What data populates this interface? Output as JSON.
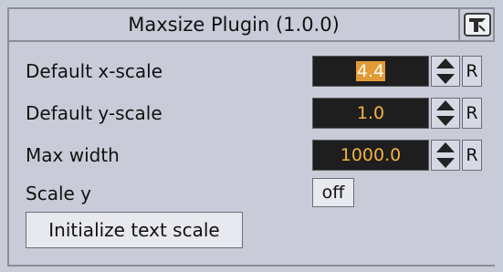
{
  "header": {
    "title": "Maxsize Plugin (1.0.0)",
    "icon": "plugin-info-icon"
  },
  "fields": [
    {
      "label": "Default x-scale",
      "value": "4.4",
      "selected": true,
      "reset_label": "R"
    },
    {
      "label": "Default y-scale",
      "value": "1.0",
      "selected": false,
      "reset_label": "R"
    },
    {
      "label": "Max width",
      "value": "1000.0",
      "selected": false,
      "reset_label": "R"
    }
  ],
  "scale_y": {
    "label": "Scale y",
    "value": "off"
  },
  "actions": {
    "initialize_label": "Initialize text scale"
  },
  "colors": {
    "panel_bg": "#c9ccd8",
    "field_bg": "#1e1e1e",
    "field_text": "#f3b23f",
    "selection": "#e29a38"
  }
}
